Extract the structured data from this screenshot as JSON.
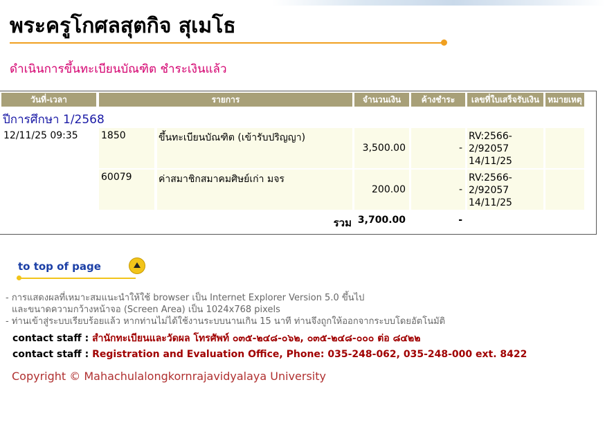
{
  "header": {
    "name": "พระครูโกศลสุตกิจ สุเมโธ",
    "subtitle": "ดำเนินการขึ้นทะเบียนบัณฑิต ชำระเงินแล้ว"
  },
  "table": {
    "columns": [
      "วันที่-เวลา",
      "รายการ",
      "จำนวนเงิน",
      "ค้างชำระ",
      "เลขที่ใบเสร็จรับเงิน",
      "หมายเหตุ"
    ],
    "year_label": "ปีการศึกษา 1/2568",
    "rows": [
      {
        "datetime": "12/11/25 09:35",
        "code": "1850",
        "description": "ขึ้นทะเบียนบัณฑิต (เข้ารับปริญญา)",
        "amount": "3,500.00",
        "outstanding": "-",
        "receipt_line1": "RV:2566-",
        "receipt_line2": "2/92057",
        "receipt_line3": "14/11/25",
        "remark": ""
      },
      {
        "datetime": "",
        "code": "60079",
        "description": "ค่าสมาชิกสมาคมศิษย์เก่า มจร",
        "amount": "200.00",
        "outstanding": "-",
        "receipt_line1": "RV:2566-",
        "receipt_line2": "2/92057",
        "receipt_line3": "14/11/25",
        "remark": ""
      }
    ],
    "total_label": "รวม",
    "total_amount": "3,700.00",
    "total_outstanding": "-"
  },
  "to_top": {
    "label": "to top of page"
  },
  "notes": {
    "line1": "- การแสดงผลที่เหมาะสมแนะนำให้ใช้ browser เป็น Internet Explorer Version 5.0 ขึ้นไป",
    "line2": "และขนาดความกว้างหน้าจอ (Screen Area) เป็น 1024x768 pixels",
    "line3": "- ท่านเข้าสู่ระบบเรียบร้อยแล้ว หากท่านไม่ได้ใช้งานระบบนานเกิน 15 นาที ท่านจึงถูกให้ออกจากระบบโดยอัตโนมัติ"
  },
  "contact": {
    "label": "contact staff :",
    "thai": "สำนักทะเบียนและวัดผล โทรศัพท์ ๐๓๕-๒๔๘-๐๖๒, ๐๓๕-๒๔๘-๐๐๐ ต่อ ๘๔๒๒",
    "english": "Registration and Evaluation Office, Phone: 035-248-062, 035-248-000 ext. 8422"
  },
  "footer": {
    "copyright": "Copyright © Mahachulalongkornrajavidyalaya University"
  },
  "colors": {
    "subtitle": "#d4006f",
    "header_bg": "#a8a078",
    "row_bg": "#fbfbe8",
    "year_label": "#1a1aa6",
    "accent_rule": "#f0a020",
    "contact_value": "#a00000"
  }
}
